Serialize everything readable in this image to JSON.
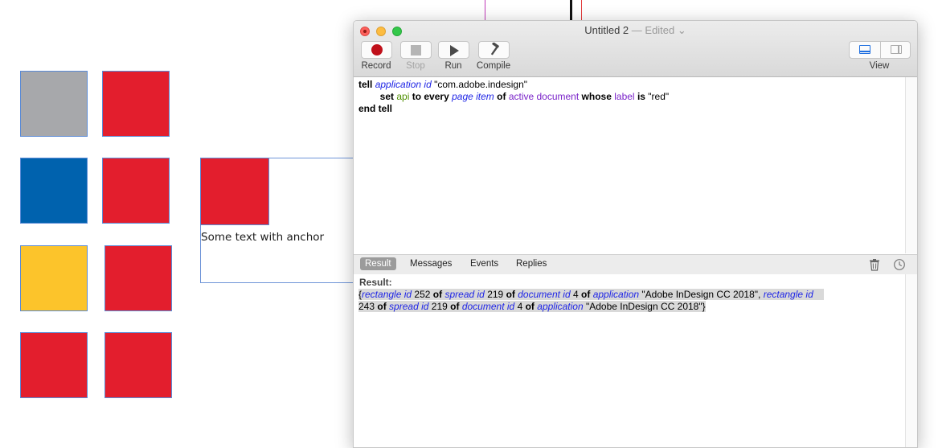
{
  "canvas": {
    "swatch_colors": {
      "gray": "#a7a8ab",
      "red": "#e31e2d",
      "blue": "#0062ae",
      "yellow": "#fcc42b",
      "frame_edge": "#5b8bd6"
    },
    "anchored_text": "Some text with anchor"
  },
  "window": {
    "title": "Untitled 2",
    "title_suffix": "— Edited ⌄",
    "toolbar": {
      "record": "Record",
      "stop": "Stop",
      "run": "Run",
      "compile": "Compile",
      "view": "View"
    },
    "script_tokens": {
      "tell": "tell",
      "application": "application",
      "id": "id",
      "app_id": "\"com.adobe.indesign\"",
      "set": "set",
      "api": "api",
      "to_every": "to every",
      "page_item": "page item",
      "of": "of",
      "active_document": "active document",
      "whose": "whose",
      "label": "label",
      "is": "is",
      "red": "\"red\"",
      "end_tell": "end tell"
    },
    "tabs": [
      "Result",
      "Messages",
      "Events",
      "Replies"
    ],
    "result": {
      "header": "Result:",
      "open_brace": "{",
      "rectangle": "rectangle",
      "id": "id",
      "rect1_id": "252",
      "rect2_id": "243",
      "of": "of",
      "spread": "spread",
      "spread_id": "219",
      "document": "document",
      "document_id": "4",
      "application": "application",
      "app_name": "\"Adobe InDesign CC 2018\"",
      "comma": ",",
      "close_brace": "}"
    },
    "colors": {
      "class_blue": "#1f25e6",
      "property_purple": "#7a23c9",
      "variable_green": "#4e8f00",
      "record_red": "#c0101a",
      "view_blue": "#1f6fe0"
    }
  }
}
